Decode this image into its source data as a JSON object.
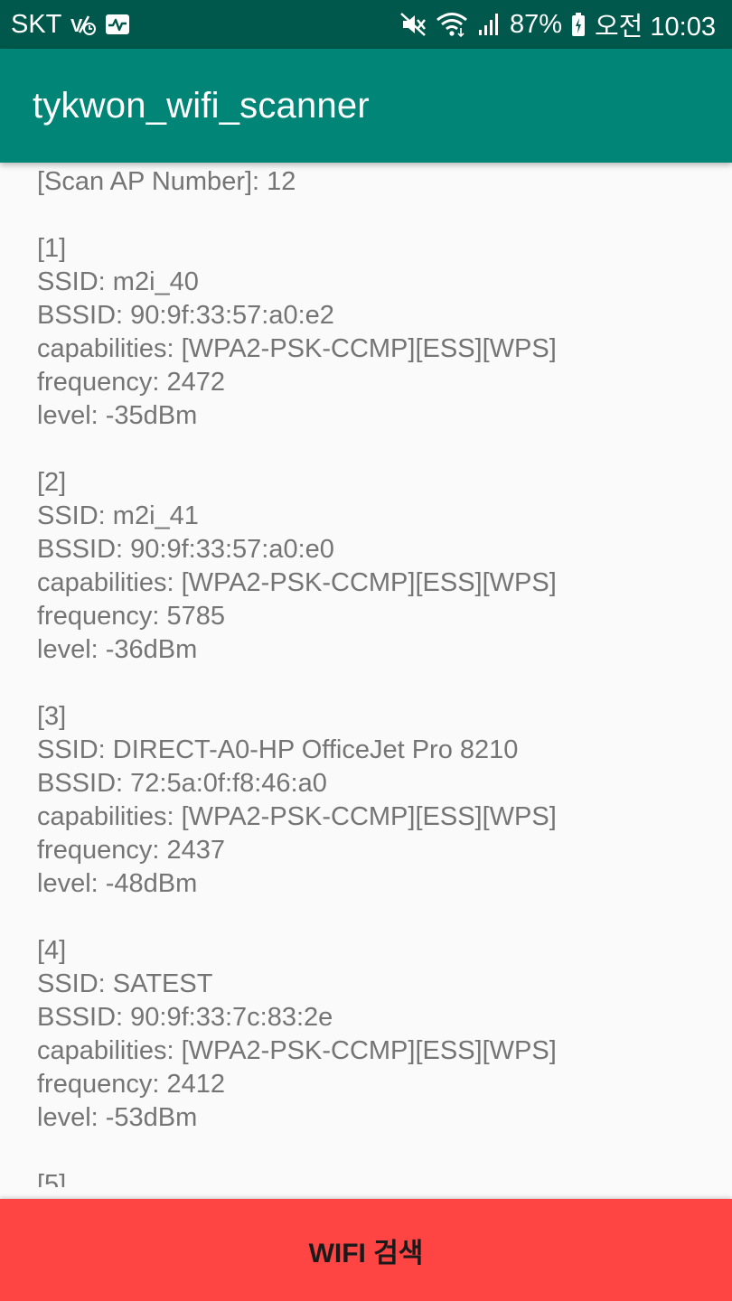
{
  "status_bar": {
    "carrier": "SKT",
    "left_icons": [
      "volte-icon",
      "activity-icon"
    ],
    "right_icons": [
      "mute-icon",
      "wifi-icon",
      "signal-icon",
      "battery-charging-icon"
    ],
    "battery": "87%",
    "time": "오전 10:03"
  },
  "app_bar": {
    "title": "tykwon_wifi_scanner"
  },
  "scan_result": {
    "text": "[Scan AP Number]: 12\n\n[1]\nSSID: m2i_40\nBSSID: 90:9f:33:57:a0:e2\ncapabilities: [WPA2-PSK-CCMP][ESS][WPS]\nfrequency: 2472\nlevel: -35dBm\n\n[2]\nSSID: m2i_41\nBSSID: 90:9f:33:57:a0:e0\ncapabilities: [WPA2-PSK-CCMP][ESS][WPS]\nfrequency: 5785\nlevel: -36dBm\n\n[3]\nSSID: DIRECT-A0-HP OfficeJet Pro 8210\nBSSID: 72:5a:0f:f8:46:a0\ncapabilities: [WPA2-PSK-CCMP][ESS][WPS]\nfrequency: 2437\nlevel: -48dBm\n\n[4]\nSSID: SATEST\nBSSID: 90:9f:33:7c:83:2e\ncapabilities: [WPA2-PSK-CCMP][ESS][WPS]\nfrequency: 2412\nlevel: -53dBm\n\n[5]"
  },
  "actions": {
    "scan_button_label": "WIFI 검색"
  },
  "colors": {
    "status_bar": "#00574b",
    "app_bar": "#008577",
    "button": "#ff4444",
    "body_text": "#757575",
    "background": "#fafafa"
  }
}
